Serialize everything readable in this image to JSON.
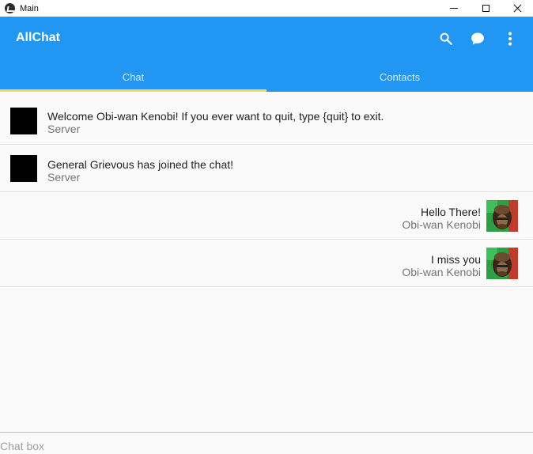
{
  "window": {
    "title": "Main"
  },
  "appbar": {
    "title": "AllChat",
    "color": "#2196f3",
    "indicator_color": "#ffd54f",
    "actions": [
      "search-icon",
      "chat-bubble-icon",
      "more-vert-icon"
    ]
  },
  "tabs": [
    {
      "label": "Chat",
      "active": true
    },
    {
      "label": "Contacts",
      "active": false
    }
  ],
  "messages": [
    {
      "text": "Welcome Obi-wan Kenobi! If you ever want to quit, type {quit} to exit.",
      "sender": "Server",
      "align": "left"
    },
    {
      "text": "General Grievous has joined the chat!",
      "sender": "Server",
      "align": "left"
    },
    {
      "text": "Hello There!",
      "sender": "Obi-wan Kenobi",
      "align": "right"
    },
    {
      "text": "I miss you",
      "sender": "Obi-wan Kenobi",
      "align": "right"
    }
  ],
  "chatbox": {
    "placeholder": "Chat box",
    "value": ""
  }
}
